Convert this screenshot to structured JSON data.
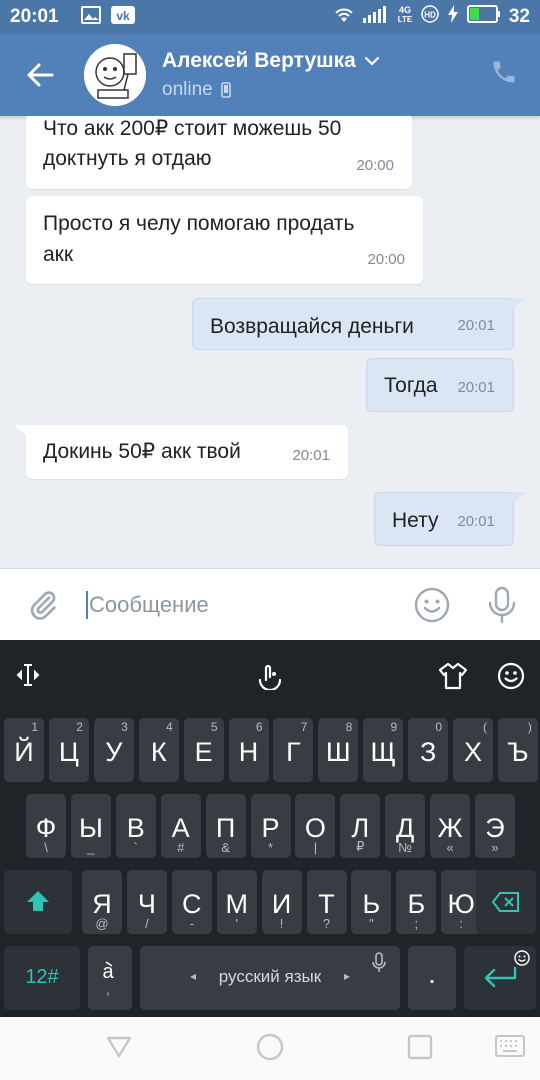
{
  "status_bar": {
    "time": "20:01",
    "battery": "32",
    "network": "4G LTE"
  },
  "header": {
    "name": "Алексей Вертушка",
    "status": "online"
  },
  "messages": [
    {
      "dir": "in",
      "lines": [
        "Что акк 200₽ стоит можешь 50",
        "доктнуть я отдаю"
      ],
      "time": "20:00"
    },
    {
      "dir": "in",
      "lines": [
        "Просто я челу помогаю продать",
        "акк"
      ],
      "time": "20:00"
    },
    {
      "dir": "out",
      "text": "Возвращайся деньги",
      "time": "20:01"
    },
    {
      "dir": "out",
      "text": "Тогда",
      "time": "20:01"
    },
    {
      "dir": "in",
      "text": "Докинь 50₽ акк твой",
      "time": "20:01"
    },
    {
      "dir": "out",
      "text": "Нету",
      "time": "20:01"
    }
  ],
  "composer": {
    "placeholder": "Сообщение"
  },
  "keyboard": {
    "row1": [
      [
        "Й",
        "1"
      ],
      [
        "Ц",
        "2"
      ],
      [
        "У",
        "3"
      ],
      [
        "К",
        "4"
      ],
      [
        "Е",
        "5"
      ],
      [
        "Н",
        "6"
      ],
      [
        "Г",
        "7"
      ],
      [
        "Ш",
        "8"
      ],
      [
        "Щ",
        "9"
      ],
      [
        "З",
        "0"
      ],
      [
        "Х",
        "("
      ],
      [
        "Ъ",
        ")"
      ]
    ],
    "row2": [
      [
        "Ф",
        "\\"
      ],
      [
        "Ы",
        "_"
      ],
      [
        "В",
        "`"
      ],
      [
        "А",
        "#"
      ],
      [
        "П",
        "&"
      ],
      [
        "Р",
        "*"
      ],
      [
        "О",
        "|"
      ],
      [
        "Л",
        "₽"
      ],
      [
        "Д",
        "№"
      ],
      [
        "Ж",
        "«"
      ],
      [
        "Э",
        "»"
      ]
    ],
    "row3": [
      [
        "Я",
        "@"
      ],
      [
        "Ч",
        "/"
      ],
      [
        "С",
        "-"
      ],
      [
        "М",
        "'"
      ],
      [
        "И",
        "!"
      ],
      [
        "Т",
        "?"
      ],
      [
        "Ь",
        "\""
      ],
      [
        "Б",
        ";"
      ],
      [
        "Ю",
        ":"
      ]
    ],
    "numbers_label": "12#",
    "space_label": "русский язык",
    "period_label": "."
  }
}
